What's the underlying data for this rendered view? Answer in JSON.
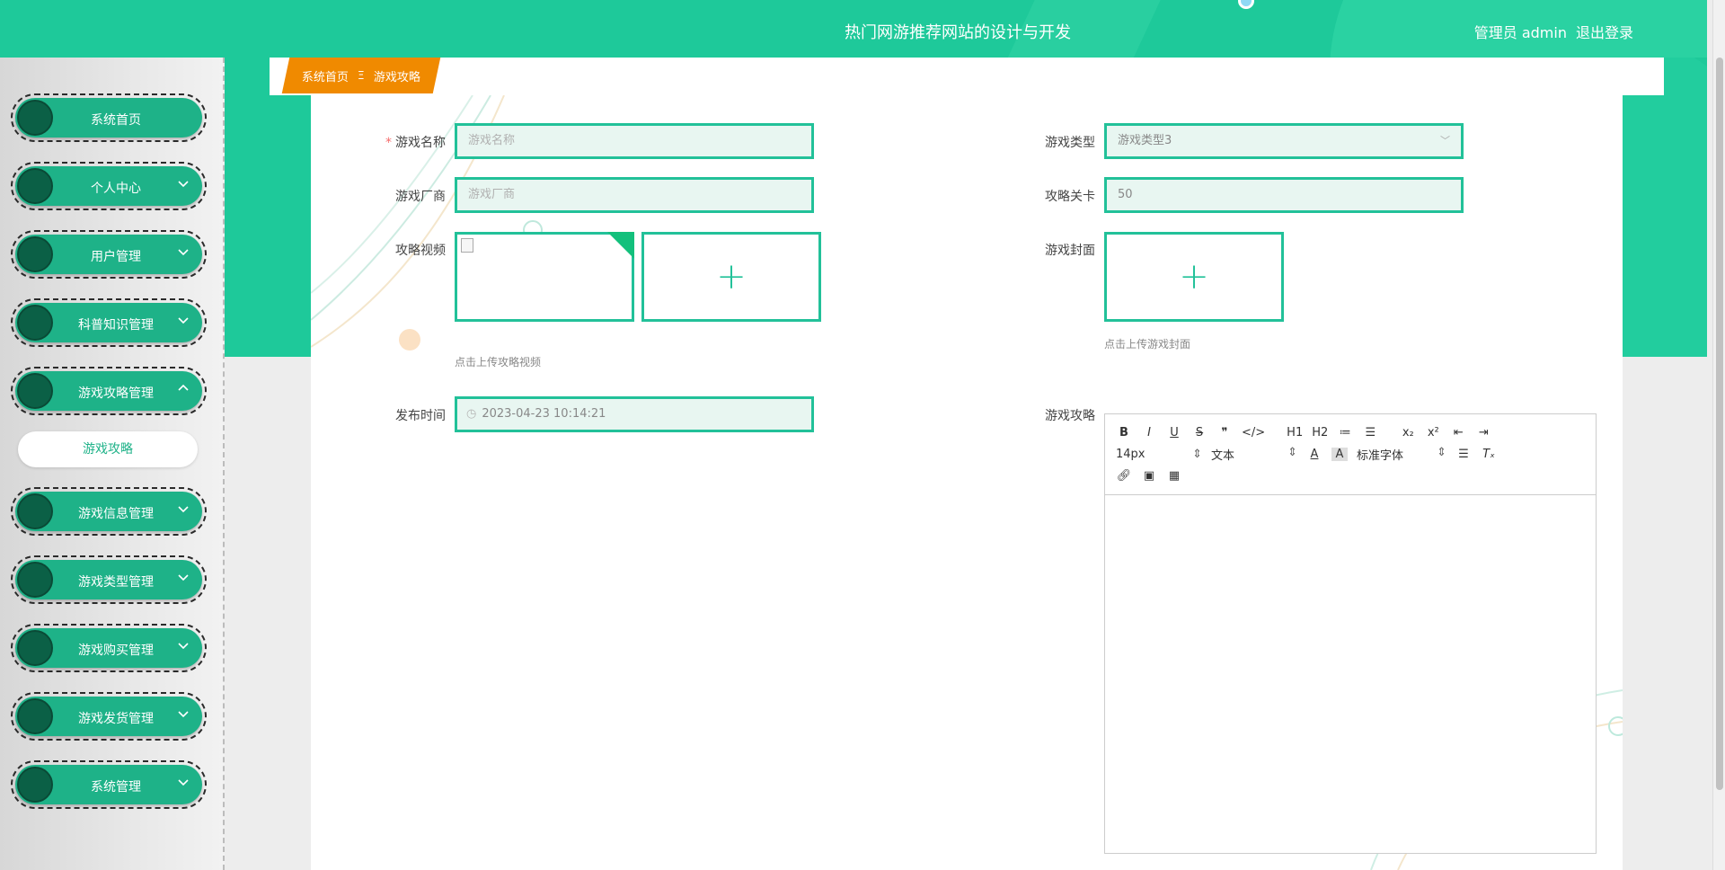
{
  "header": {
    "title": "热门网游推荐网站的设计与开发",
    "user_label": "管理员 admin",
    "logout": "退出登录"
  },
  "sidebar": {
    "items": [
      {
        "label": "系统首页",
        "chevron": ""
      },
      {
        "label": "个人中心",
        "chevron": "down"
      },
      {
        "label": "用户管理",
        "chevron": "down"
      },
      {
        "label": "科普知识管理",
        "chevron": "down"
      },
      {
        "label": "游戏攻略管理",
        "chevron": "up"
      },
      {
        "label": "游戏信息管理",
        "chevron": "down"
      },
      {
        "label": "游戏类型管理",
        "chevron": "down"
      },
      {
        "label": "游戏购买管理",
        "chevron": "down"
      },
      {
        "label": "游戏发货管理",
        "chevron": "down"
      },
      {
        "label": "系统管理",
        "chevron": "down"
      }
    ],
    "submenu": {
      "label": "游戏攻略"
    }
  },
  "breadcrumb": {
    "home": "系统首页",
    "separator": "Ξ",
    "current": "游戏攻略"
  },
  "form": {
    "game_name": {
      "label": "游戏名称",
      "required_mark": "*",
      "placeholder": "游戏名称"
    },
    "game_vendor": {
      "label": "游戏厂商",
      "placeholder": "游戏厂商"
    },
    "guide_video": {
      "label": "攻略视频",
      "hint": "点击上传攻略视频"
    },
    "publish_time": {
      "label": "发布时间",
      "value": "2023-04-23 10:14:21"
    },
    "game_type": {
      "label": "游戏类型",
      "value": "游戏类型3"
    },
    "guide_level": {
      "label": "攻略关卡",
      "value": "50"
    },
    "game_cover": {
      "label": "游戏封面",
      "hint": "点击上传游戏封面"
    },
    "game_guide": {
      "label": "游戏攻略"
    }
  },
  "editor": {
    "row1": [
      "B",
      "I",
      "U",
      "S",
      "❞",
      "</>",
      "H1",
      "H2",
      "≔",
      "☰",
      "x₂",
      "x²",
      "⇤",
      "⇥"
    ],
    "font_size": "14px",
    "block_type": "文本",
    "font_family": "标准字体",
    "row3": [
      "link",
      "image",
      "video"
    ]
  },
  "colors": {
    "primary": "#1ec99a",
    "menu_green": "#1eb288",
    "breadcrumb_orange": "#f08a00",
    "input_border": "#22c199",
    "input_bg": "#e8f6f1"
  }
}
